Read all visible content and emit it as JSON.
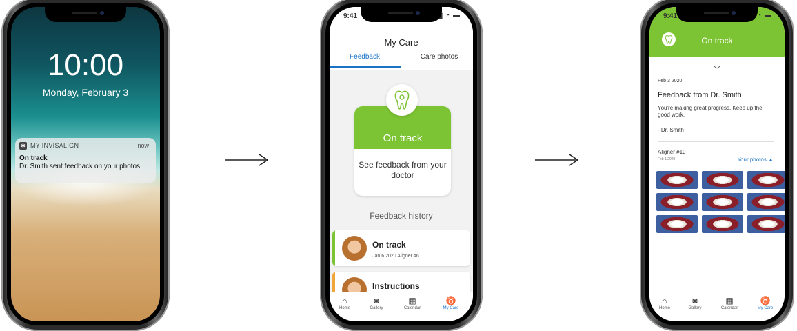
{
  "lock_screen": {
    "time": "10:00",
    "date": "Monday, February 3",
    "notification": {
      "app": "MY INVISALIGN",
      "when": "now",
      "title": "On track",
      "message": "Dr. Smith sent feedback on your photos"
    }
  },
  "my_care": {
    "status_time": "9:41",
    "title": "My Care",
    "tabs": [
      "Feedback",
      "Care photos"
    ],
    "card": {
      "status": "On track",
      "cta": "See feedback from your doctor"
    },
    "history_title": "Feedback history",
    "history": [
      {
        "title": "On track",
        "subtitle": "Jan 6 2020 Aligner #6",
        "color": "#7cc434"
      },
      {
        "title": "Instructions",
        "subtitle": "",
        "color": "#f0a63a"
      }
    ]
  },
  "detail": {
    "status_time": "9:41",
    "header": "On track",
    "date": "Feb 3 2020",
    "heading": "Feedback from Dr. Smith",
    "message": "You're making great progress. Keep up the good work.",
    "signature": "- Dr. Smith",
    "aligner": "Aligner #10",
    "aligner_date": "Feb 1 2020",
    "photos_toggle": "Your photos ▲",
    "photo_count": 9
  },
  "tabbar": [
    {
      "label": "Home",
      "icon": "home-icon"
    },
    {
      "label": "Gallery",
      "icon": "camera-icon"
    },
    {
      "label": "Calendar",
      "icon": "calendar-icon"
    },
    {
      "label": "My Care",
      "icon": "tooth-icon"
    }
  ],
  "colors": {
    "green": "#7cc434",
    "blue": "#1a73c7",
    "orange": "#f0a63a"
  }
}
